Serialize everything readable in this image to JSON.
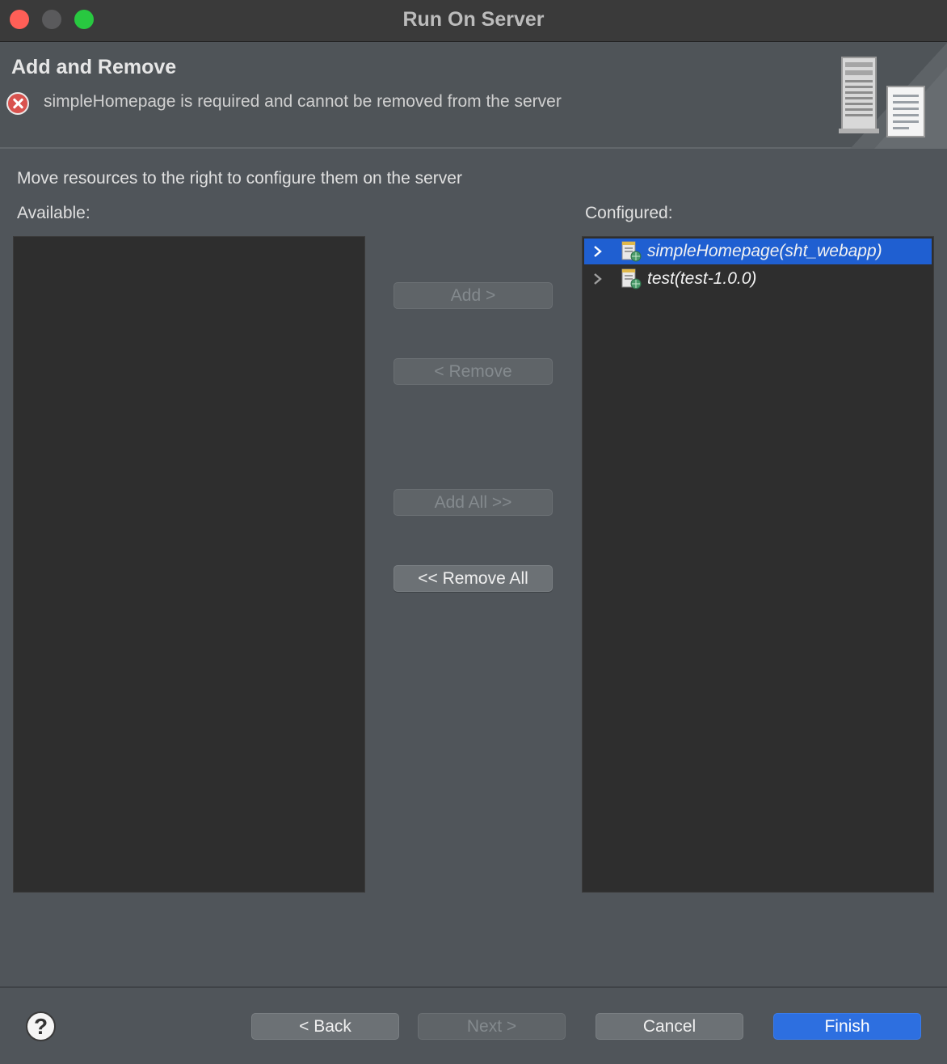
{
  "window": {
    "title": "Run On Server"
  },
  "header": {
    "title": "Add and Remove",
    "message": "simpleHomepage is required and cannot be removed from the server"
  },
  "instruction": "Move resources to the right to configure them on the server",
  "available": {
    "label": "Available:",
    "items": []
  },
  "configured": {
    "label": "Configured:",
    "items": [
      {
        "label": "simpleHomepage(sht_webapp)",
        "selected": true
      },
      {
        "label": "test(test-1.0.0)",
        "selected": false
      }
    ]
  },
  "buttons": {
    "add": "Add >",
    "remove": "< Remove",
    "add_all": "Add All >>",
    "remove_all": "<< Remove All"
  },
  "footer": {
    "help": "?",
    "back": "< Back",
    "next": "Next >",
    "cancel": "Cancel",
    "finish": "Finish"
  },
  "colors": {
    "accent": "#2d6fe0",
    "selection": "#1f5fd1",
    "error": "#d9534f"
  }
}
